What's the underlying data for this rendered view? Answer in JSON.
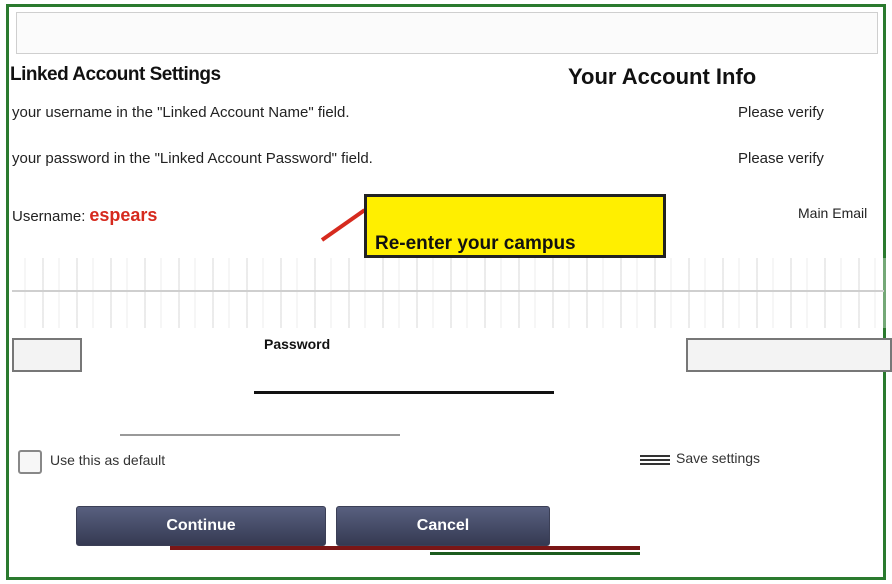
{
  "header": {
    "left_title": "Linked Account Settings",
    "right_title": "Your Account Info"
  },
  "instructions": {
    "line1": "your username in the \"Linked Account Name\" field.",
    "line2": "your password in the \"Linked Account Password\" field."
  },
  "username": {
    "label": "Username:",
    "value": "espears"
  },
  "right_panel": {
    "line1": "Please verify",
    "line2": "Please verify",
    "main_email_label": "Main Email"
  },
  "callout": {
    "text": "Re-enter your campus"
  },
  "password": {
    "label": "Password",
    "sub": ""
  },
  "options": {
    "checkbox_label": "Use this as default",
    "right_note": "Save settings"
  },
  "buttons": {
    "continue": "Continue",
    "cancel": "Cancel"
  },
  "colors": {
    "frame": "#2a7a2e",
    "callout_bg": "#ffef00",
    "username_value": "#d62a1e",
    "button_dark": "#353a52"
  }
}
